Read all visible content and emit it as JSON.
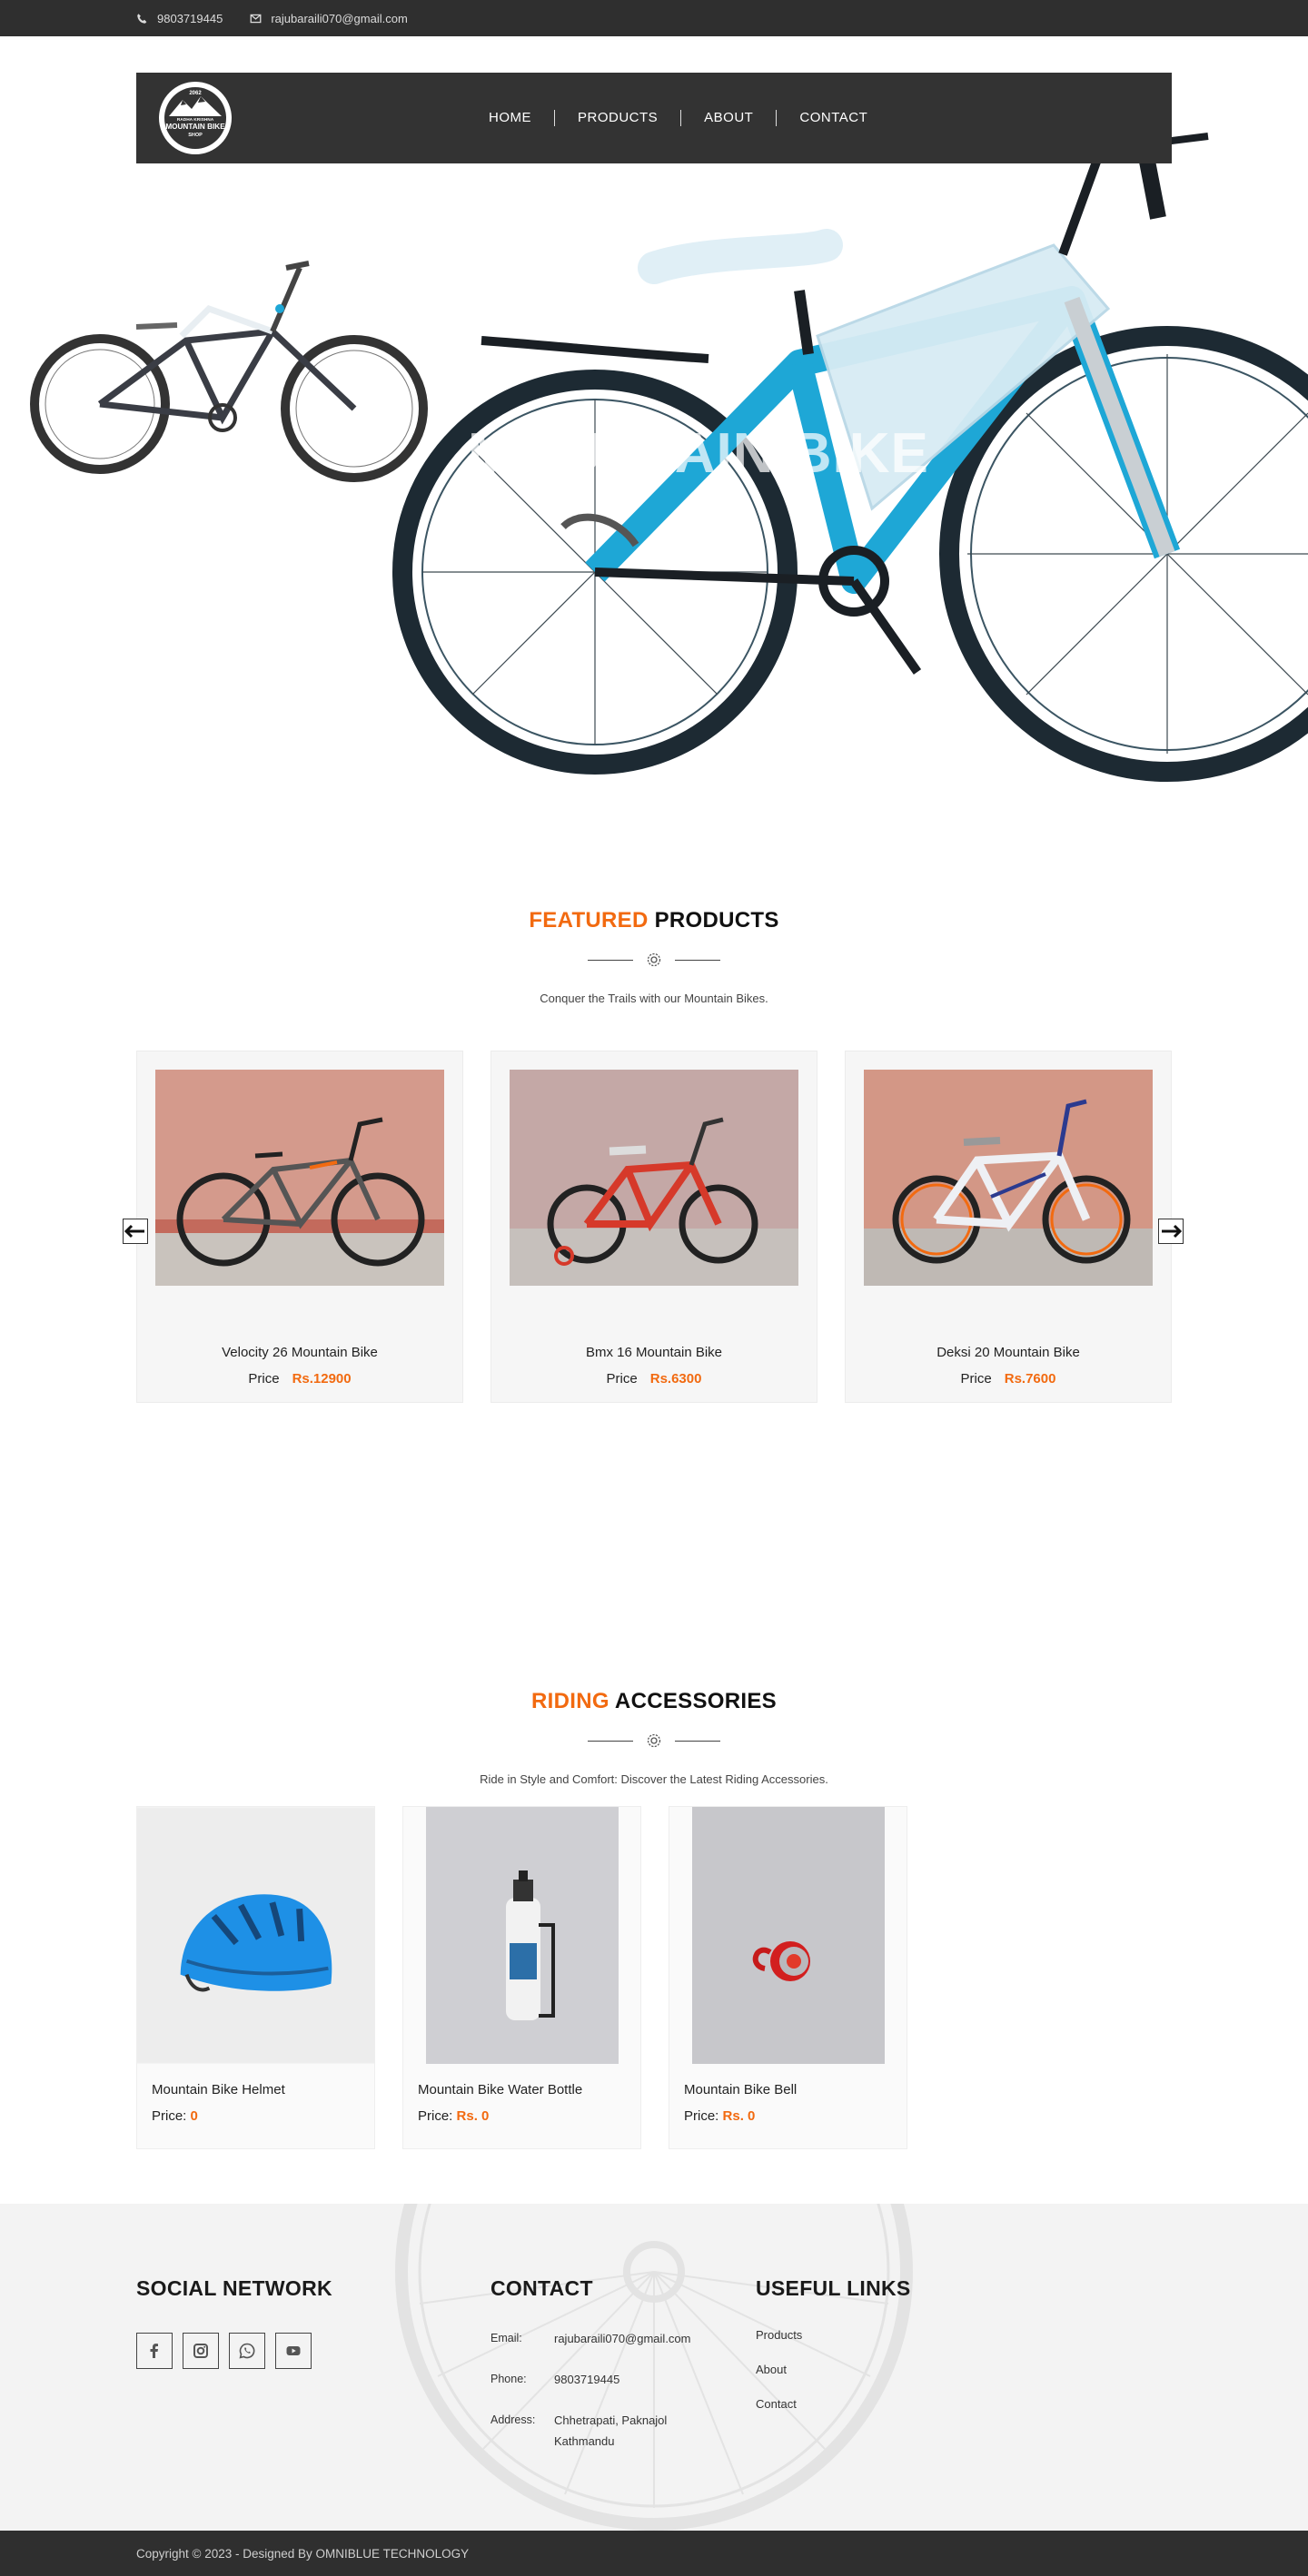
{
  "topbar": {
    "phone": "9803719445",
    "email": "rajubaraili070@gmail.com",
    "phone_icon": "phone-icon",
    "email_icon": "envelope-icon"
  },
  "logo": {
    "line1": "RADHA KRISHNA",
    "line2": "MOUNTAIN BIKE",
    "line3": "SHOP",
    "est": "2062"
  },
  "nav": {
    "items": [
      "HOME",
      "PRODUCTS",
      "ABOUT",
      "CONTACT"
    ]
  },
  "hero": {
    "title": "MOUNTAIN BIKE"
  },
  "featured": {
    "title_accent": "FEATURED",
    "title_rest": " PRODUCTS",
    "subtitle": "Conquer the Trails with our Mountain Bikes.",
    "price_label": "Price",
    "products": [
      {
        "name": "Velocity 26 Mountain Bike",
        "price": "Rs.12900"
      },
      {
        "name": "Bmx 16 Mountain Bike",
        "price": "Rs.6300"
      },
      {
        "name": "Deksi 20 Mountain Bike",
        "price": "Rs.7600"
      }
    ]
  },
  "accessories": {
    "title_accent": "RIDING",
    "title_rest": " ACCESSORIES",
    "subtitle": "Ride in Style and Comfort: Discover the Latest Riding Accessories.",
    "price_label": "Price: ",
    "items": [
      {
        "name": "Mountain Bike Helmet",
        "price": "0"
      },
      {
        "name": "Mountain Bike Water Bottle",
        "price": "Rs. 0"
      },
      {
        "name": "Mountain Bike Bell",
        "price": "Rs. 0"
      }
    ]
  },
  "footer": {
    "social_title": "SOCIAL NETWORK",
    "contact_title": "CONTACT",
    "links_title": "USEFUL LINKS",
    "email_label": "Email:",
    "email": "rajubaraili070@gmail.com",
    "phone_label": "Phone:",
    "phone": "9803719445",
    "address_label": "Address:",
    "address_line1": "Chhetrapati, Paknajol",
    "address_line2": "Kathmandu",
    "links": [
      "Products",
      "About",
      "Contact"
    ],
    "social_icons": [
      "facebook-icon",
      "instagram-icon",
      "whatsapp-icon",
      "youtube-icon"
    ]
  },
  "copyright": "Copyright © 2023 - Designed By OMNIBLUE TECHNOLOGY",
  "colors": {
    "accent": "#f26a10",
    "dark_bar": "#2f2f2f",
    "nav_bg": "#333333",
    "bike_blue": "#1ea7d6"
  }
}
